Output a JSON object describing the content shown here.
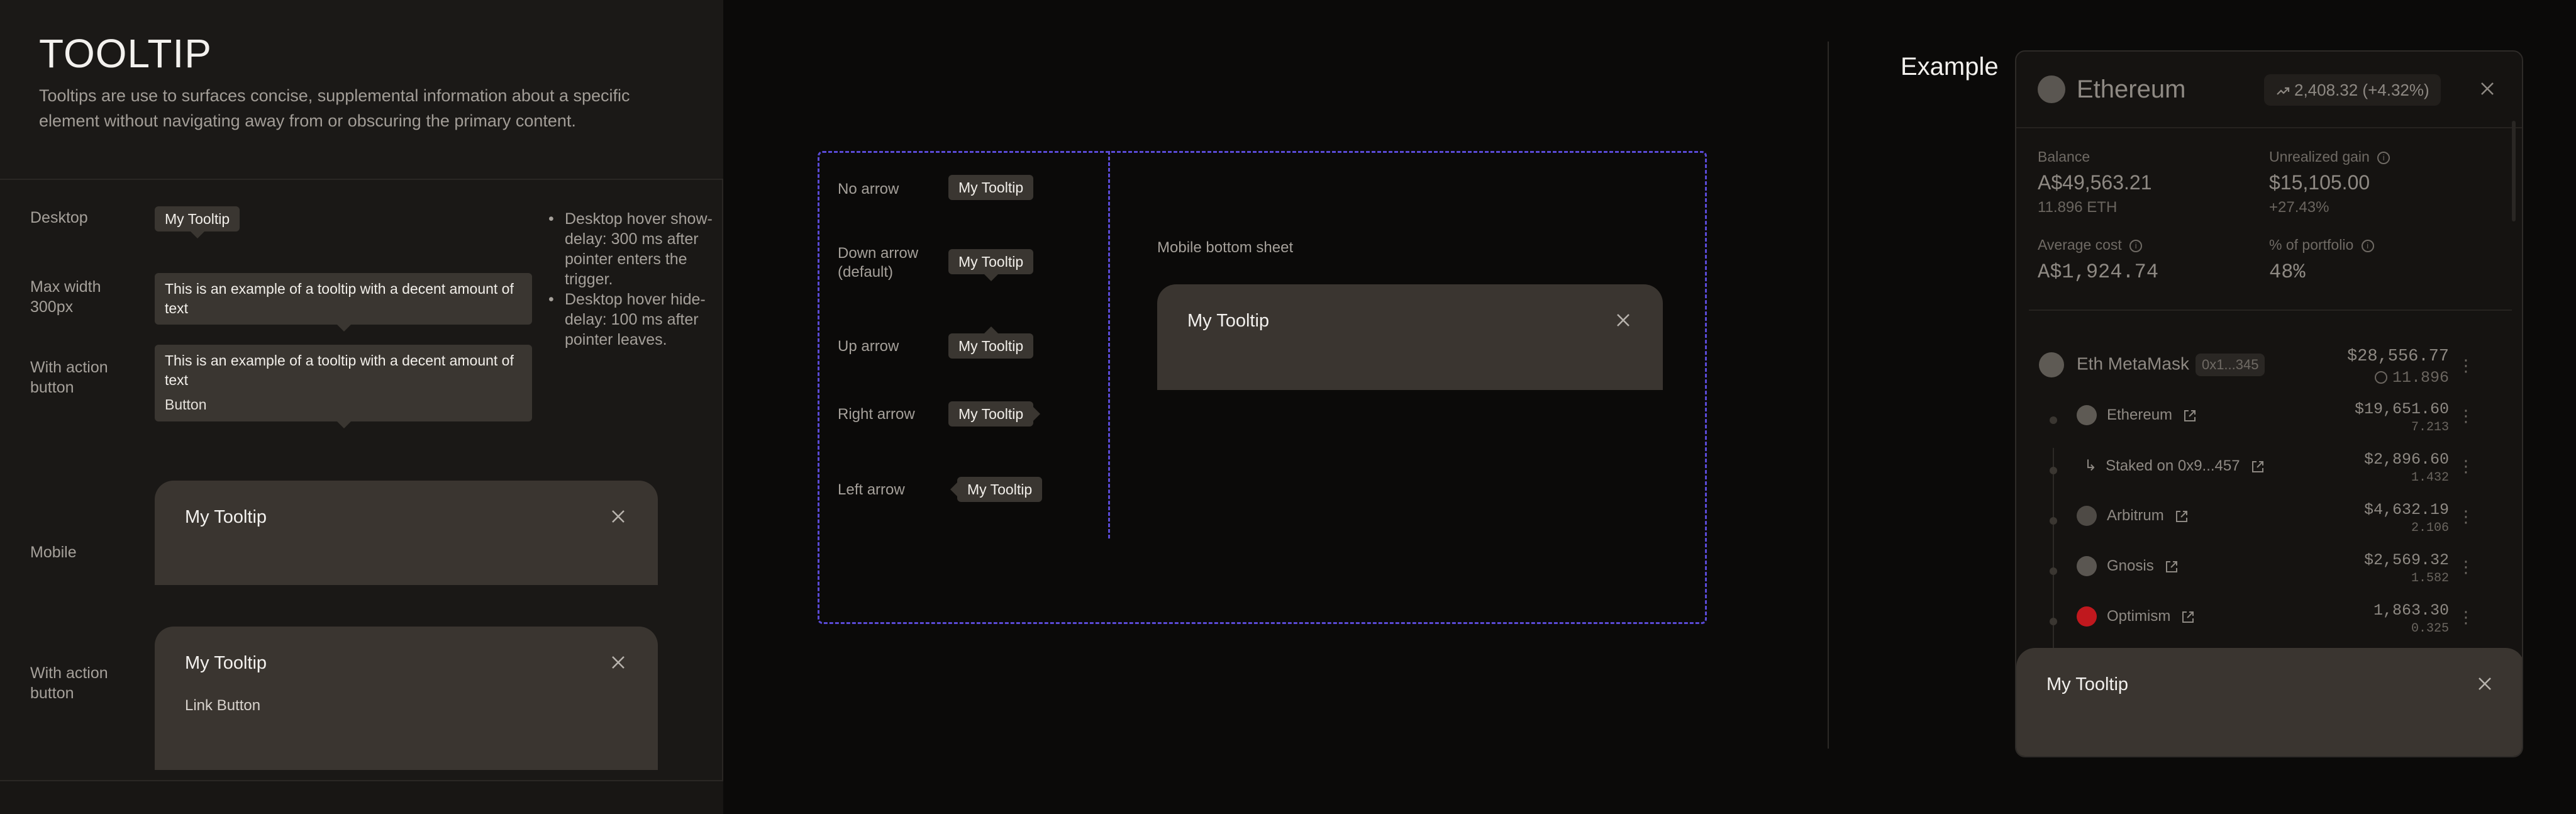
{
  "header": {
    "title": "TOOLTIP",
    "description": "Tooltips are use to surfaces concise, supplemental information about a specific element without navigating away from or obscuring the primary content."
  },
  "rows": {
    "desktop": {
      "label": "Desktop",
      "tooltip": "My Tooltip"
    },
    "max_width": {
      "label": "Max width 300px",
      "tooltip": "This is an example of a tooltip with a decent amount of text"
    },
    "with_action": {
      "label": "With action button",
      "tooltip": "This is an example of a tooltip with a decent amount of text",
      "button": "Button"
    },
    "mobile": {
      "label": "Mobile",
      "title": "My Tooltip"
    },
    "mobile_action": {
      "label": "With action button",
      "title": "My Tooltip",
      "link": "Link Button"
    }
  },
  "notes": [
    "Desktop hover show-delay: 300 ms after pointer enters the trigger.",
    "Desktop hover hide-delay: 100 ms after pointer leaves."
  ],
  "arrows": {
    "no_arrow": {
      "label": "No arrow",
      "tooltip": "My Tooltip"
    },
    "down_arrow": {
      "label": "Down arrow (default)",
      "tooltip": "My Tooltip"
    },
    "up_arrow": {
      "label": "Up arrow",
      "tooltip": "My Tooltip"
    },
    "right_arrow": {
      "label": "Right arrow",
      "tooltip": "My Tooltip"
    },
    "left_arrow": {
      "label": "Left arrow",
      "tooltip": "My Tooltip"
    }
  },
  "mobile_sheet": {
    "label": "Mobile bottom sheet",
    "title": "My Tooltip"
  },
  "example": {
    "title": "Example",
    "asset": "Ethereum",
    "change": "2,408.32 (+4.32%)",
    "balance_label": "Balance",
    "balance": "A$49,563.21",
    "balance_sub": "11.896 ETH",
    "unrealized_label": "Unrealized gain",
    "unrealized": "$15,105.00",
    "unrealized_sub": "+27.43%",
    "avg_cost_label": "Average cost",
    "avg_cost": "A$1,924.74",
    "portfolio_label": "% of portfolio",
    "portfolio": "48%",
    "wallet": {
      "name": "Eth MetaMask",
      "addr": "0x1...345",
      "value": "$28,556.77",
      "sub": "11.896"
    },
    "chains": [
      {
        "name": "Ethereum",
        "value": "$19,651.60",
        "sub": "7.213"
      },
      {
        "name": "Staked on 0x9...457",
        "value": "$2,896.60",
        "sub": "1.432"
      },
      {
        "name": "Arbitrum",
        "value": "$4,632.19",
        "sub": "2.106"
      },
      {
        "name": "Gnosis",
        "value": "$2,569.32",
        "sub": "1.582"
      },
      {
        "name": "Optimism",
        "value": "1,863.30",
        "sub": "0.325"
      }
    ],
    "sheet_title": "My Tooltip"
  },
  "colors": {
    "accent_dashed": "#5a4ad6",
    "optimism_red": "#c0181e",
    "tooltip_bg": "#3a3631"
  }
}
